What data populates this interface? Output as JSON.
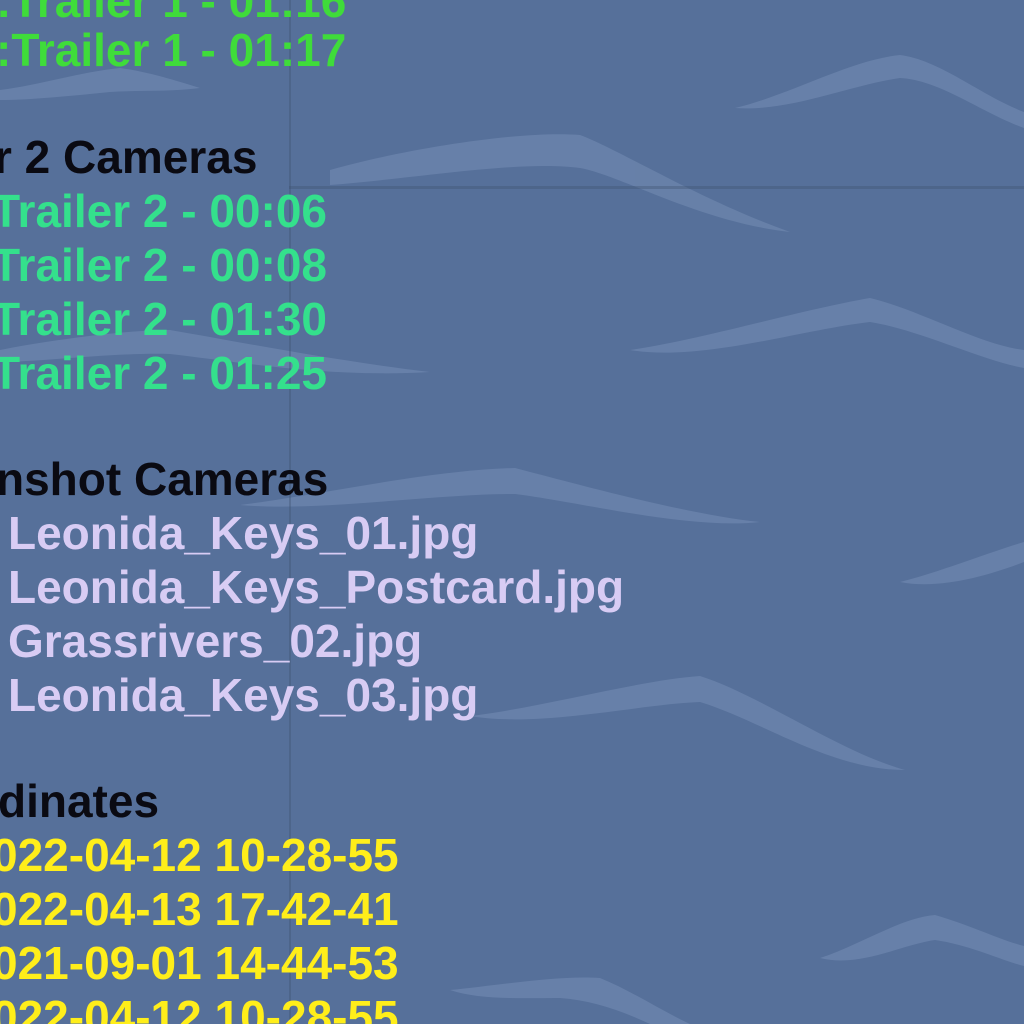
{
  "colors": {
    "background": "#56709a",
    "wave": "#6d86ad",
    "trailer1": "#3fdc3a",
    "trailer2": "#34e08c",
    "screenshot": "#d8ccf4",
    "coordinates": "#ffee1a",
    "heading": "#0a0a12"
  },
  "trailer1": {
    "items": [
      ":Trailer 1 - 01:16",
      ":Trailer 1 - 01:17"
    ]
  },
  "trailer2": {
    "heading": "r 2 Cameras",
    "items": [
      "Trailer 2 - 00:06",
      "Trailer 2 - 00:08",
      "Trailer 2 - 01:30",
      "Trailer 2 - 01:25"
    ]
  },
  "screenshots": {
    "heading": "nshot Cameras",
    "items": [
      "Leonida_Keys_01.jpg",
      "Leonida_Keys_Postcard.jpg",
      "Grassrivers_02.jpg",
      "Leonida_Keys_03.jpg"
    ]
  },
  "coordinates": {
    "heading": "dinates",
    "items": [
      "022-04-12 10-28-55",
      "022-04-13 17-42-41",
      "021-09-01 14-44-53",
      "022-04-12 10-28-55"
    ]
  }
}
